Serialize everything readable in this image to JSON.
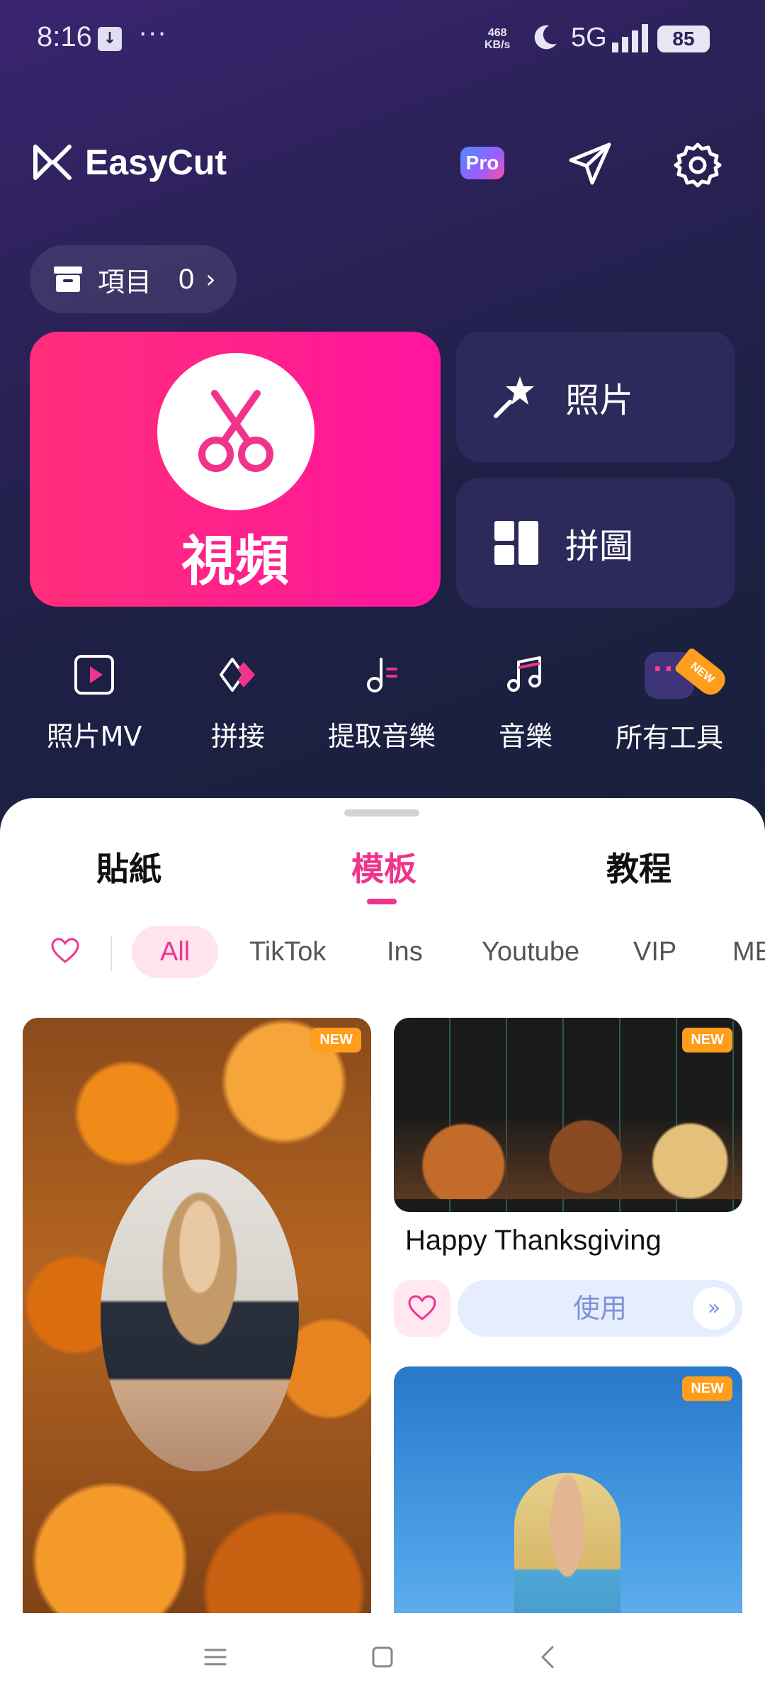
{
  "status_bar": {
    "time": "8:16",
    "more": "···",
    "speed_value": "468",
    "speed_unit": "KB/s",
    "network": "5G",
    "battery": "85"
  },
  "header": {
    "app_name": "EasyCut",
    "pro_label": "Pro"
  },
  "projects": {
    "label": "項目",
    "count": "0",
    "chevron": "›"
  },
  "main_actions": {
    "video_label": "視頻",
    "photo_label": "照片",
    "collage_label": "拼圖"
  },
  "tools": [
    {
      "label": "照片MV",
      "icon": "play-square-icon"
    },
    {
      "label": "拼接",
      "icon": "merge-icon"
    },
    {
      "label": "提取音樂",
      "icon": "music-extract-icon"
    },
    {
      "label": "音樂",
      "icon": "music-note-icon"
    },
    {
      "label": "所有工具",
      "icon": "more-dots-icon"
    }
  ],
  "new_tag": "NEW",
  "sheet": {
    "tabs": [
      {
        "label": "貼紙",
        "active": false
      },
      {
        "label": "模板",
        "active": true
      },
      {
        "label": "教程",
        "active": false
      }
    ],
    "chips": [
      "All",
      "TikTok",
      "Ins",
      "Youtube",
      "VIP",
      "ME"
    ],
    "active_chip": "All",
    "new_badge": "NEW",
    "template_title": "Happy Thanksgiving",
    "use_label": "使用",
    "use_arrow": "»"
  },
  "colors": {
    "accent": "#f0348c",
    "video_card": "#ff1f8e",
    "side_card": "#2d2a5b",
    "new_badge": "#ff9d1c"
  }
}
